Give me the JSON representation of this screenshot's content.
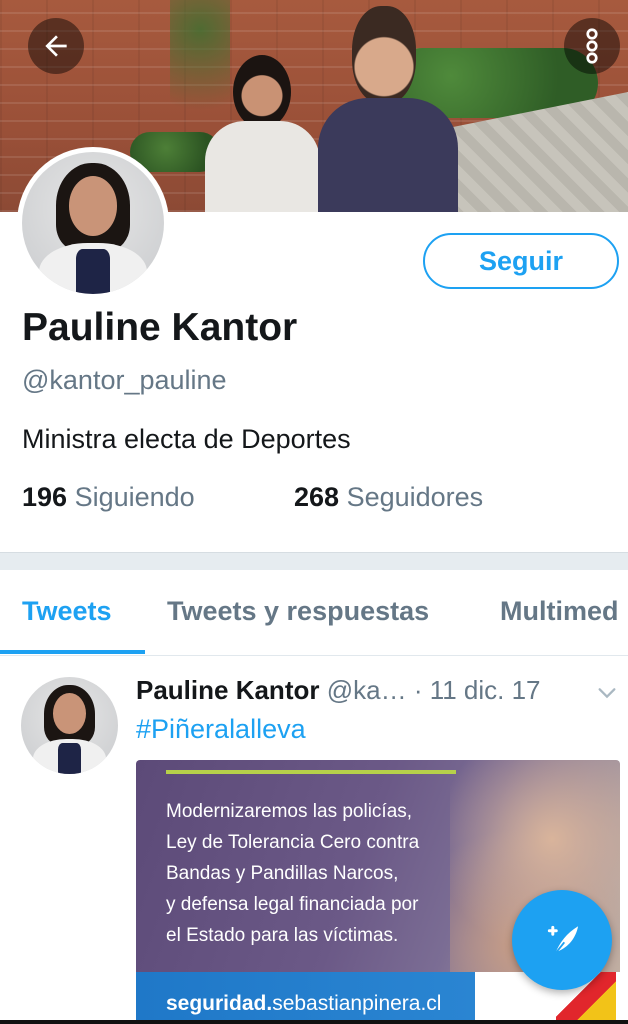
{
  "profile": {
    "name": "Pauline Kantor",
    "handle": "@kantor_pauline",
    "bio": "Ministra electa de Deportes",
    "following_count": "196",
    "following_label": "Siguiendo",
    "followers_count": "268",
    "followers_label": "Seguidores",
    "follow_label": "Seguir"
  },
  "tabs": [
    {
      "label": "Tweets",
      "active": true
    },
    {
      "label": "Tweets y respuestas",
      "active": false
    },
    {
      "label": "Multimed",
      "active": false
    }
  ],
  "tweet": {
    "author": "Pauline Kantor",
    "handle": "@ka…",
    "date": "· 11 dic. 17",
    "hashtag": "#Piñeralalleva",
    "media": {
      "lines": [
        "Modernizaremos las policías,",
        "Ley de Tolerancia Cero contra",
        "Bandas y Pandillas Narcos,",
        "y defensa legal financiada por",
        "el Estado para las víctimas."
      ],
      "url_bold": "seguridad.",
      "url_rest": "sebastianpinera.cl"
    }
  },
  "icons": {
    "back": "arrow-left-icon",
    "more": "more-vertical-icon",
    "chevron": "chevron-down-icon",
    "compose": "compose-feather-icon"
  },
  "colors": {
    "accent": "#1da1f2",
    "secondary_text": "#657786",
    "primary_text": "#14171a",
    "separator": "#e6ecf0"
  }
}
